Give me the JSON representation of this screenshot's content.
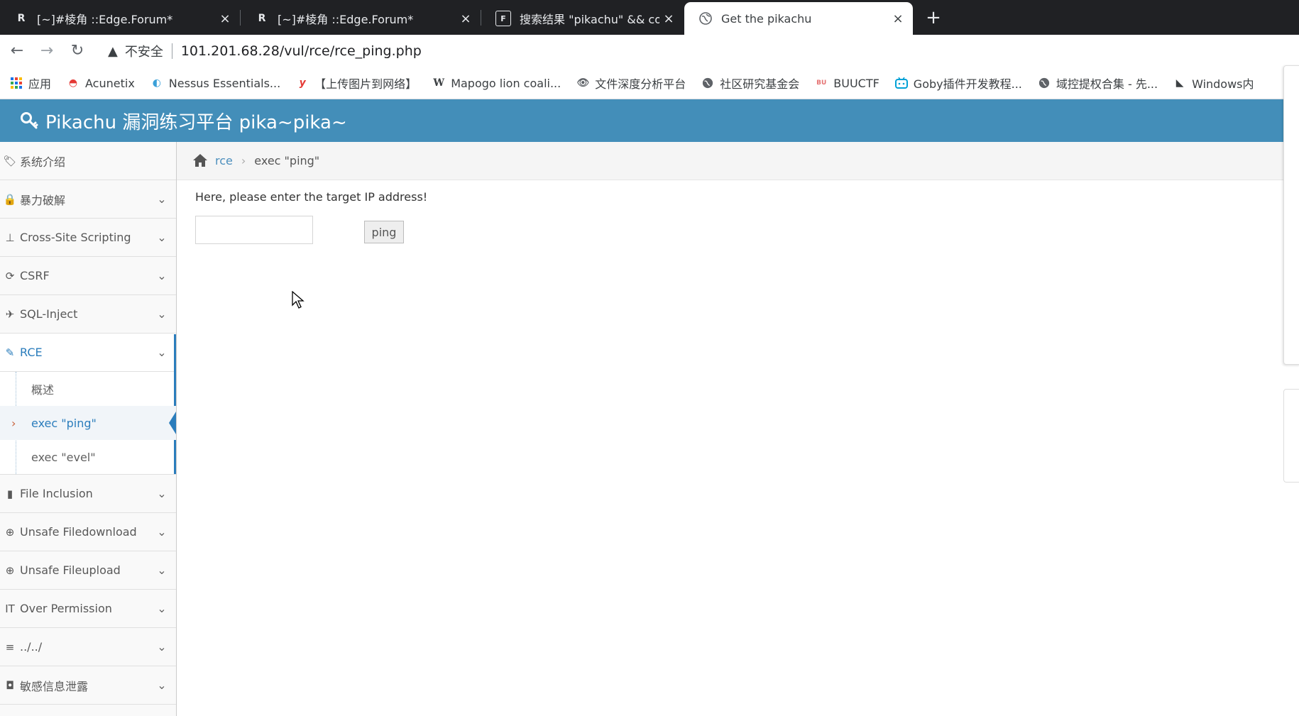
{
  "browser": {
    "tabs": [
      {
        "title": "[~]#棱角 ::Edge.Forum*",
        "icon": "R"
      },
      {
        "title": "[~]#棱角 ::Edge.Forum*",
        "icon": "R"
      },
      {
        "title": "搜索结果 \"pikachu\" && countr",
        "icon": "F"
      },
      {
        "title": "Get the pikachu",
        "icon": "globe"
      }
    ],
    "close_glyph": "×",
    "new_tab_glyph": "+",
    "insecure_label": "不安全",
    "url": "101.201.68.28/vul/rce/rce_ping.php",
    "bookmarks": [
      {
        "label": "应用",
        "icon": "apps-grid-icon"
      },
      {
        "label": "Acunetix",
        "icon": "acunetix-icon"
      },
      {
        "label": "Nessus Essentials...",
        "icon": "nessus-icon"
      },
      {
        "label": "【上传图片到网络】",
        "icon": "y-icon"
      },
      {
        "label": "Mapogo lion coali...",
        "icon": "wikipedia-icon"
      },
      {
        "label": "文件深度分析平台",
        "icon": "eye-icon"
      },
      {
        "label": "社区研究基金会",
        "icon": "globe-icon"
      },
      {
        "label": "BUUCTF",
        "icon": "buuctf-icon"
      },
      {
        "label": "Goby插件开发教程...",
        "icon": "bilibili-icon"
      },
      {
        "label": "域控提权合集 - 先...",
        "icon": "globe-icon"
      },
      {
        "label": "Windows内",
        "icon": "windows-icon"
      }
    ]
  },
  "app": {
    "title": "Pikachu 漏洞练习平台 pika~pika~",
    "header_color": "#438eb9"
  },
  "sidebar": {
    "items": [
      {
        "label": "系统介绍",
        "icon": "tags-icon",
        "has_chevron": false
      },
      {
        "label": "暴力破解",
        "icon": "lock-icon",
        "has_chevron": true
      },
      {
        "label": "Cross-Site Scripting",
        "icon": "sitemap-icon",
        "has_chevron": true
      },
      {
        "label": "CSRF",
        "icon": "share-icon",
        "has_chevron": true
      },
      {
        "label": "SQL-Inject",
        "icon": "plane-icon",
        "has_chevron": true
      },
      {
        "label": "RCE",
        "icon": "pencil-icon",
        "has_chevron": true,
        "open": true
      },
      {
        "label": "File Inclusion",
        "icon": "file-icon",
        "has_chevron": true
      },
      {
        "label": "Unsafe Filedownload",
        "icon": "download-icon",
        "has_chevron": true
      },
      {
        "label": "Unsafe Fileupload",
        "icon": "upload-icon",
        "has_chevron": true
      },
      {
        "label": "Over Permission",
        "icon": "text-height-icon",
        "has_chevron": true
      },
      {
        "label": "../../",
        "icon": "list-icon",
        "has_chevron": true
      },
      {
        "label": "敏感信息泄露",
        "icon": "camera-icon",
        "has_chevron": true
      }
    ],
    "rce_submenu": [
      {
        "label": "概述"
      },
      {
        "label": "exec \"ping\"",
        "active": true
      },
      {
        "label": "exec \"evel\""
      }
    ]
  },
  "breadcrumb": {
    "link": "rce",
    "separator": "›",
    "current": "exec \"ping\""
  },
  "main": {
    "prompt": "Here, please enter the target IP address!",
    "input_value": "",
    "button_label": "ping"
  }
}
